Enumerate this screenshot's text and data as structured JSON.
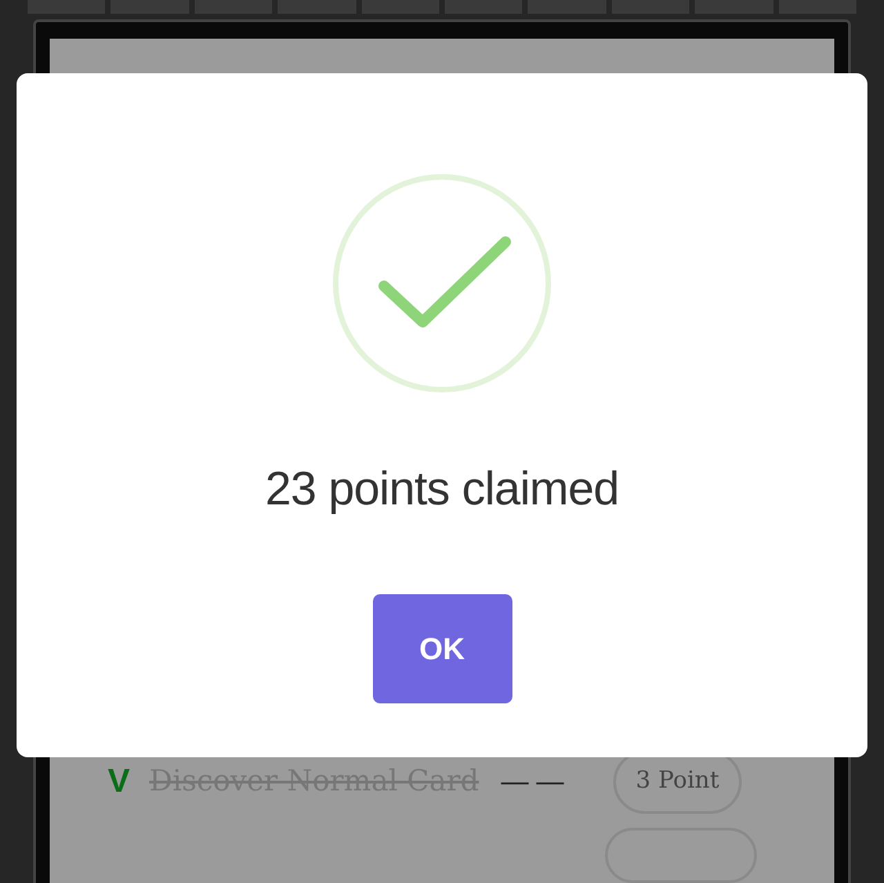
{
  "background_task": {
    "mark": "V",
    "label": "Discover Normal Card",
    "done": true,
    "separator": "— —",
    "points": "3 Point"
  },
  "dialog": {
    "kind": "success",
    "title": "23 points claimed",
    "button": "OK"
  }
}
